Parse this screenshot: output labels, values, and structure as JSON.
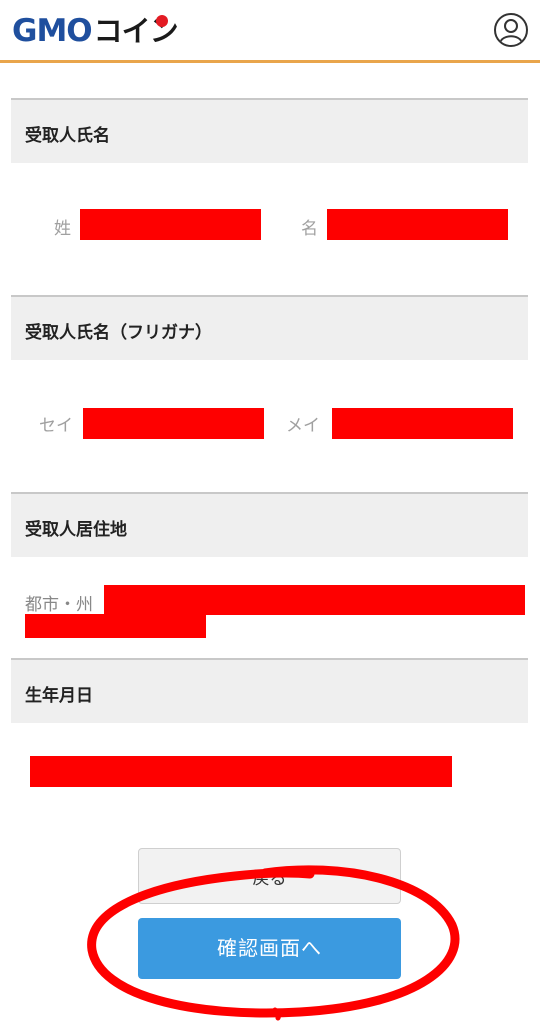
{
  "header": {
    "logo_gmo": "GMO",
    "logo_coin": "コイン",
    "account_icon": "user-circle-icon",
    "accent_color": "#e9a54b"
  },
  "sections": {
    "recipient_name": {
      "title": "受取人氏名",
      "last_name_label": "姓",
      "first_name_label": "名"
    },
    "recipient_kana": {
      "title": "受取人氏名（フリガナ）",
      "last_name_label": "セイ",
      "first_name_label": "メイ"
    },
    "recipient_address": {
      "title": "受取人居住地",
      "city_label": "都市・州"
    },
    "birthdate": {
      "title": "生年月日"
    }
  },
  "buttons": {
    "back_label": "戻る",
    "confirm_label": "確認画面へ",
    "confirm_color": "#3b9ae0"
  },
  "annotation": {
    "circle_color": "#fe0000"
  }
}
